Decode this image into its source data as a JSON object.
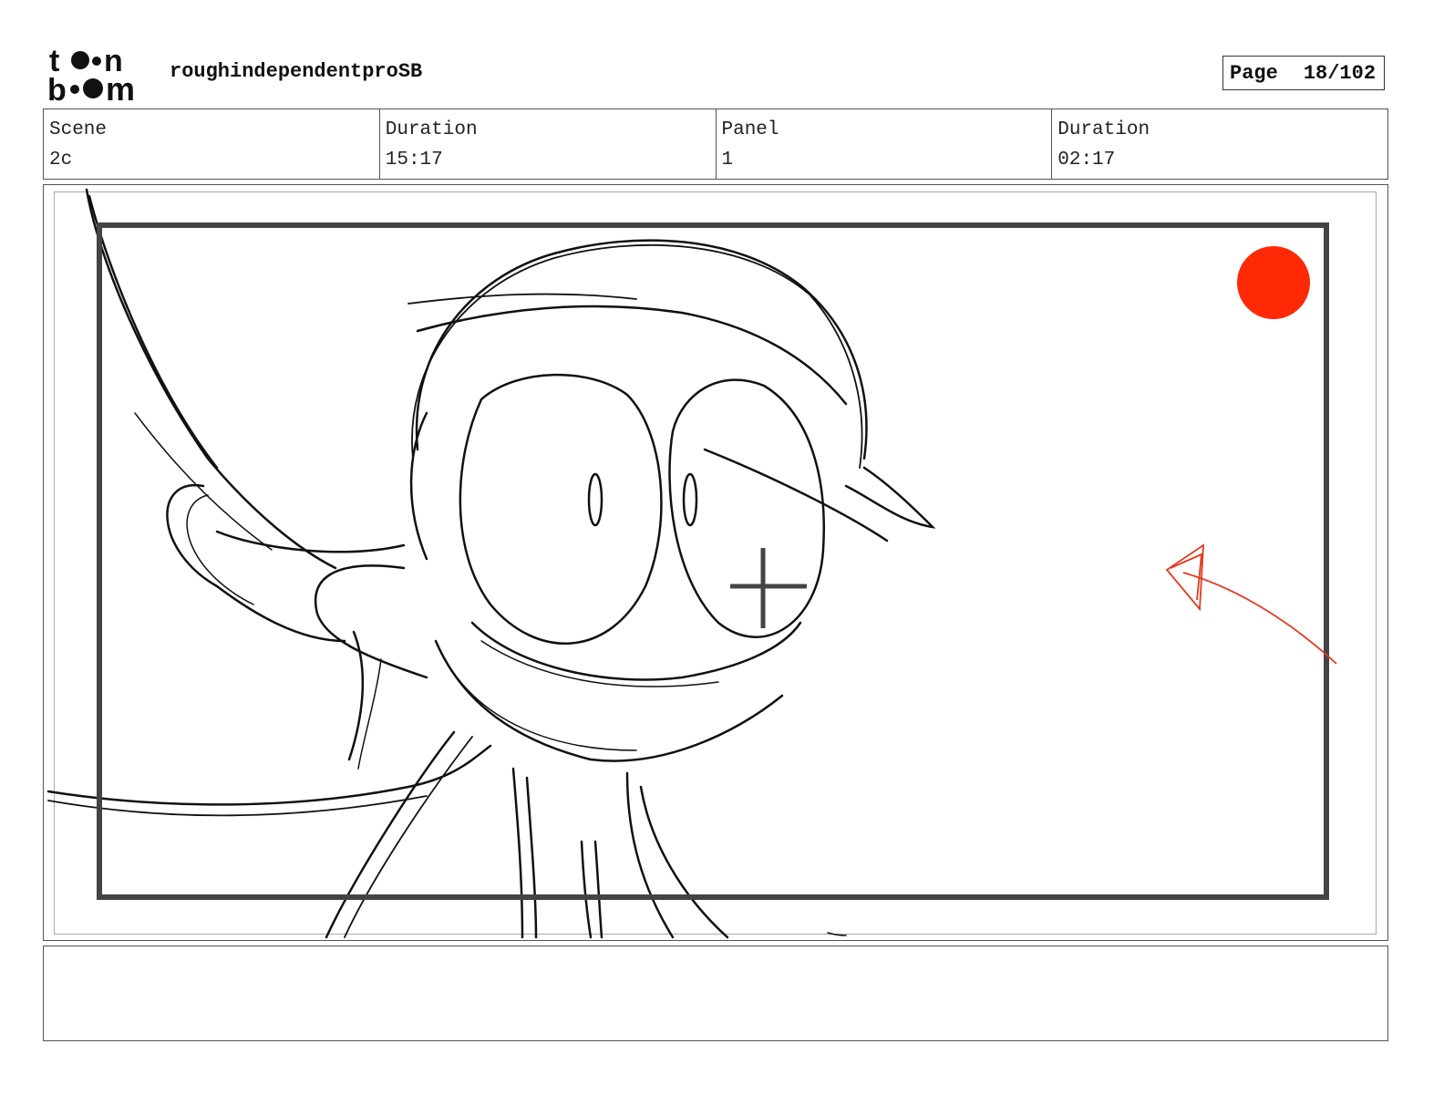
{
  "header": {
    "logo_top": "to•n",
    "logo_bottom": "b••m",
    "project_title": "roughindependentproSB",
    "page_label": "Page",
    "page_number": "18/102"
  },
  "info": {
    "scene_label": "Scene",
    "scene_value": "2c",
    "scene_duration_label": "Duration",
    "scene_duration_value": "15:17",
    "panel_label": "Panel",
    "panel_value": "1",
    "panel_duration_label": "Duration",
    "panel_duration_value": "02:17"
  },
  "panel": {
    "safe_frame_color": "#444444",
    "annotation_color": "#e8391e",
    "sketch_color": "#111111"
  },
  "notes": {
    "text": ""
  }
}
